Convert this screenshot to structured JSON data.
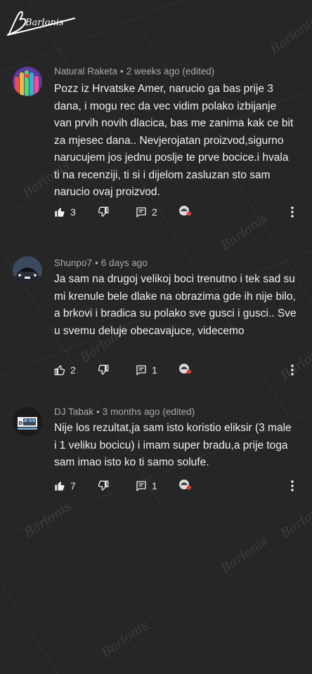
{
  "brand": {
    "logo_text": "Barlonis"
  },
  "colors": {
    "background": "#262626",
    "text": "#f1f1f1",
    "meta": "#aaaaaa",
    "heart": "#e53935"
  },
  "comments": [
    {
      "author": "Natural Raketa",
      "time": "2 weeks ago (edited)",
      "text": "Pozz iz Hrvatske Amer, narucio ga bas prije 3 dana, i mogu rec da vec vidim polako izbijanje van prvih novih dlacica, bas me zanima kak ce bit za mjesec dana.. Nevjerojatan proizvod,sigurno narucujem jos jednu poslje te prve bocice.i hvala ti na recenziji, ti si i dijelom zasluzan sto sam narucio ovaj proizvod.",
      "likes": "3",
      "liked": true,
      "replies": "2",
      "avatar_icon": "colorful-hands-icon"
    },
    {
      "author": "Shunpo7",
      "time": "6 days ago",
      "text": "Ja sam na drugoj velikoj boci trenutno i tek sad su mi krenule bele dlake na obrazima gde ih nije bilo, a brkovi i bradica su polako sve gusci i gusci.. Sve u svemu deluje obecavajuce, videcemo",
      "likes": "2",
      "liked": false,
      "replies": "1",
      "avatar_icon": "car-photo-icon"
    },
    {
      "author": "DJ Tabak",
      "time": "3 months ago (edited)",
      "text": "Nije los rezultat,ja sam isto koristio eliksir (3 male i 1 veliku bocicu) i imam super bradu,a prije toga sam imao isto ko ti samo solufe.",
      "likes": "7",
      "liked": true,
      "replies": "1",
      "avatar_icon": "dj-logo-icon"
    }
  ]
}
